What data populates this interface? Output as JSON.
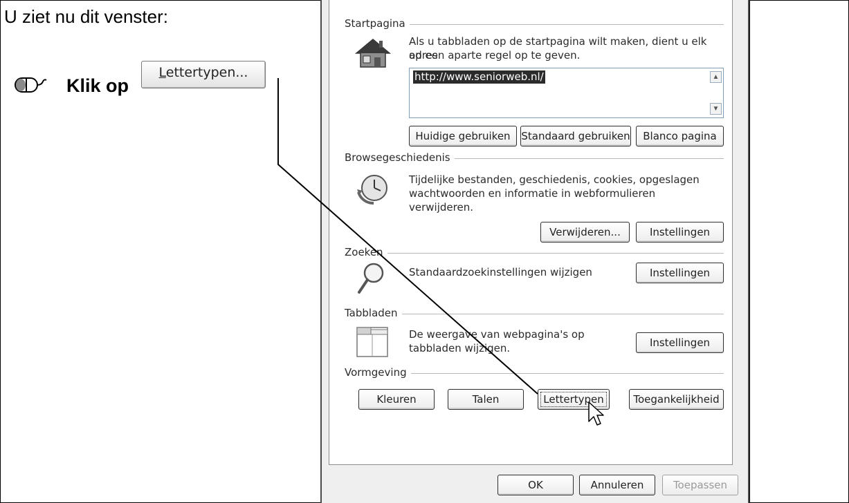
{
  "instruction": {
    "intro": "U ziet nu dit venster:",
    "action": "Klik op",
    "button_label": "Lettertypen...",
    "button_mnemonic": "L",
    "button_rest": "ettertypen..."
  },
  "dialog": {
    "startpagina": {
      "title": "Startpagina",
      "text1": "Als u tabbladen op de startpagina wilt maken, dient u elk adres",
      "text2": "op een aparte regel op te geven.",
      "url": "http://www.seniorweb.nl/",
      "btn_current": "Huidige gebruiken",
      "btn_default": "Standaard gebruiken",
      "btn_blank": "Blanco pagina"
    },
    "history": {
      "title": "Browsegeschiedenis",
      "text1": "Tijdelijke bestanden, geschiedenis, cookies, opgeslagen",
      "text2": "wachtwoorden en informatie in webformulieren",
      "text3": "verwijderen.",
      "btn_delete": "Verwijderen...",
      "btn_settings": "Instellingen"
    },
    "search": {
      "title": "Zoeken",
      "text": "Standaardzoekinstellingen wijzigen",
      "btn_settings": "Instellingen"
    },
    "tabs": {
      "title": "Tabbladen",
      "text1": "De weergave van webpagina's op",
      "text2": "tabbladen wijzigen.",
      "btn_settings": "Instellingen"
    },
    "appearance": {
      "title": "Vormgeving",
      "btn_colors": "Kleuren",
      "btn_languages": "Talen",
      "btn_fonts": "Lettertypen",
      "btn_accessibility": "Toegankelijkheid"
    },
    "footer": {
      "ok": "OK",
      "cancel": "Annuleren",
      "apply": "Toepassen"
    }
  }
}
